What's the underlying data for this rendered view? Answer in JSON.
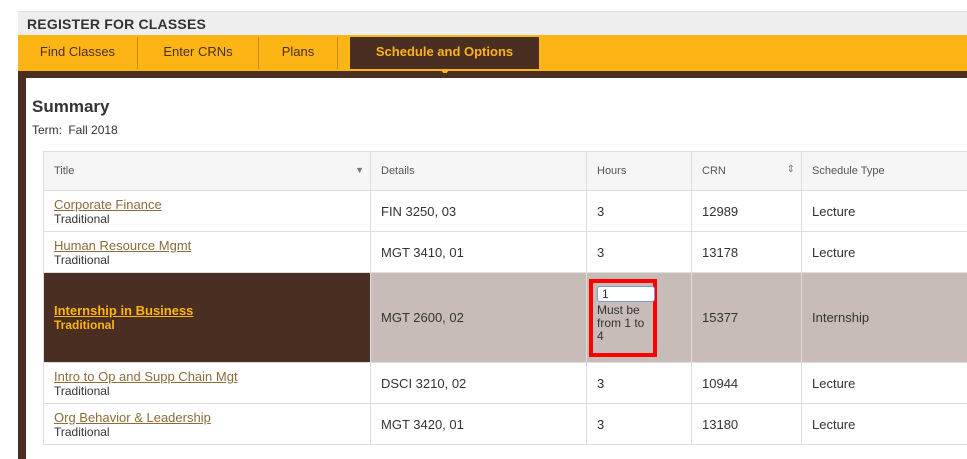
{
  "header": {
    "title": "REGISTER FOR CLASSES"
  },
  "tabs": [
    {
      "label": "Find Classes"
    },
    {
      "label": "Enter CRNs"
    },
    {
      "label": "Plans"
    },
    {
      "label": "Schedule and Options"
    }
  ],
  "summary": {
    "title": "Summary",
    "term_label": "Term:",
    "term_value": "Fall 2018"
  },
  "table": {
    "headers": {
      "title": "Title",
      "details": "Details",
      "hours": "Hours",
      "crn": "CRN",
      "schedule_type": "Schedule Type"
    },
    "rows": [
      {
        "title": "Corporate Finance",
        "type": "Traditional",
        "details": "FIN 3250, 03",
        "hours": "3",
        "crn": "12989",
        "schedule_type": "Lecture"
      },
      {
        "title": "Human Resource Mgmt",
        "type": "Traditional",
        "details": "MGT 3410, 01",
        "hours": "3",
        "crn": "13178",
        "schedule_type": "Lecture"
      },
      {
        "title": "Internship in Business",
        "type": "Traditional",
        "details": "MGT 2600, 02",
        "hours": "1",
        "hours_message": "Must be from 1 to 4",
        "crn": "15377",
        "schedule_type": "Internship"
      },
      {
        "title": "Intro to Op and Supp Chain Mgt",
        "type": "Traditional",
        "details": "DSCI 3210, 02",
        "hours": "3",
        "crn": "10944",
        "schedule_type": "Lecture"
      },
      {
        "title": "Org Behavior & Leadership",
        "type": "Traditional",
        "details": "MGT 3420, 01",
        "hours": "3",
        "crn": "13180",
        "schedule_type": "Lecture"
      }
    ]
  },
  "colors": {
    "accent_gold": "#fdb515",
    "brand_brown": "#4b2e22",
    "selected_row": "#c7bcb7",
    "link": "#8a6d3b",
    "error_outline": "#ff0000"
  }
}
